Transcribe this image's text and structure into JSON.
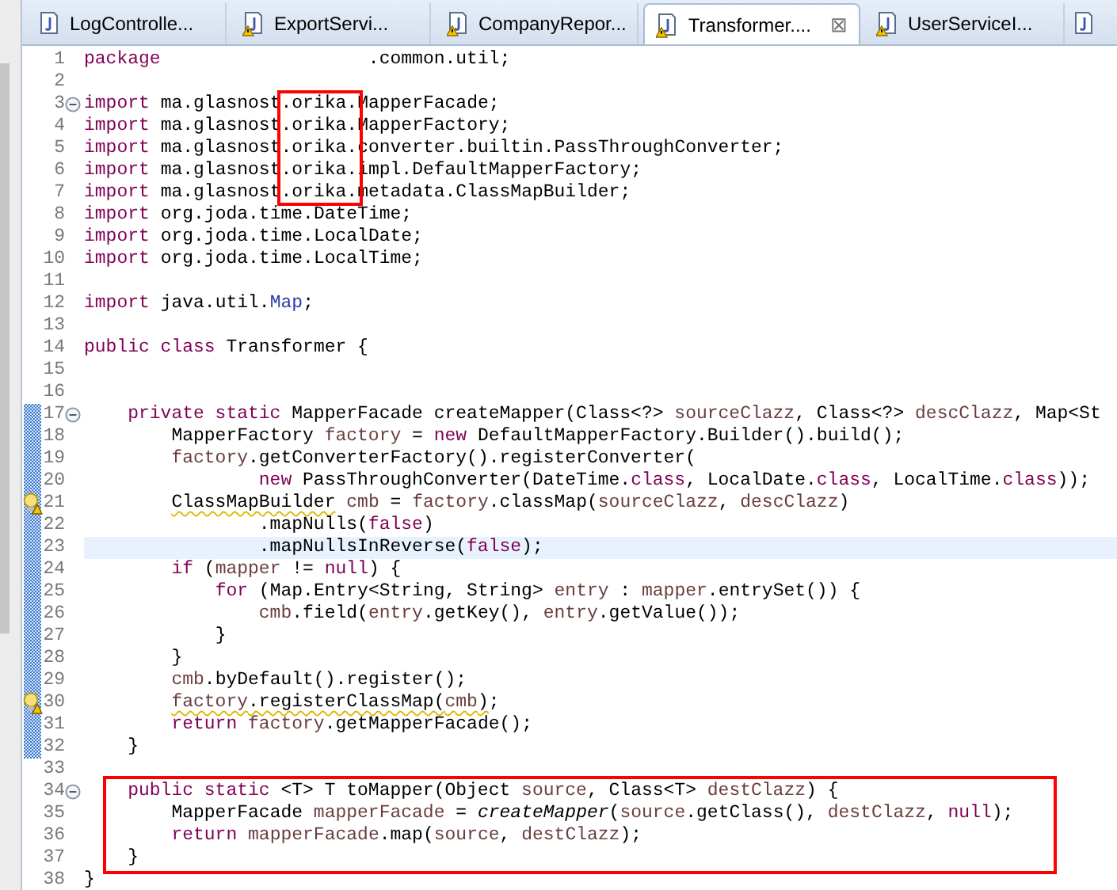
{
  "tabs": [
    {
      "label": "LogControlle...",
      "selected": false,
      "warning": false
    },
    {
      "label": "ExportServi...",
      "selected": false,
      "warning": true
    },
    {
      "label": "CompanyRepor...",
      "selected": false,
      "warning": true
    },
    {
      "label": "Transformer....",
      "selected": true,
      "warning": true,
      "close": "⊠"
    },
    {
      "label": "UserServiceI...",
      "selected": false,
      "warning": true
    },
    {
      "selected": false,
      "warning": false
    }
  ],
  "editor": {
    "lines": [
      {
        "number": "1",
        "kind": "plain",
        "changed": false,
        "current": false,
        "boxed": false,
        "tokens": [
          {
            "text": "package",
            "kind": "keyword"
          },
          {
            "text": "                   .common.util;",
            "kind": "plain"
          }
        ]
      },
      {
        "number": "2",
        "kind": "plain",
        "changed": false,
        "current": false,
        "boxed": false
      },
      {
        "number": "3",
        "kind": "fold",
        "changed": false,
        "current": false,
        "boxed": false,
        "tokens": [
          {
            "text": "import",
            "kind": "keyword"
          },
          {
            "text": " ma.glasnost",
            "kind": "plain"
          },
          {
            "text": ".orika.",
            "kind": "plain",
            "boxed": true
          },
          {
            "text": "MapperFacade;",
            "kind": "plain"
          }
        ]
      },
      {
        "number": "4",
        "kind": "plain",
        "changed": false,
        "current": false,
        "boxed": false,
        "tokens": [
          {
            "text": "import",
            "kind": "keyword"
          },
          {
            "text": " ma.glasnost",
            "kind": "plain"
          },
          {
            "text": ".orika.",
            "kind": "plain",
            "boxed": true
          },
          {
            "text": "MapperFactory;",
            "kind": "plain"
          }
        ]
      },
      {
        "number": "5",
        "kind": "plain",
        "changed": false,
        "current": false,
        "boxed": false,
        "tokens": [
          {
            "text": "import",
            "kind": "keyword"
          },
          {
            "text": " ma.glasnost",
            "kind": "plain"
          },
          {
            "text": ".orika.",
            "kind": "plain",
            "boxed": true
          },
          {
            "text": "converter.builtin.PassThroughConverter;",
            "kind": "plain"
          }
        ]
      },
      {
        "number": "6",
        "kind": "plain",
        "changed": false,
        "current": false,
        "boxed": false,
        "tokens": [
          {
            "text": "import",
            "kind": "keyword"
          },
          {
            "text": " ma.glasnost",
            "kind": "plain"
          },
          {
            "text": ".orika.",
            "kind": "plain",
            "boxed": true
          },
          {
            "text": "impl.DefaultMapperFactory;",
            "kind": "plain"
          }
        ]
      },
      {
        "number": "7",
        "kind": "plain",
        "changed": false,
        "current": false,
        "boxed": false,
        "tokens": [
          {
            "text": "import",
            "kind": "keyword"
          },
          {
            "text": " ma.glasnost",
            "kind": "plain"
          },
          {
            "text": ".orika.",
            "kind": "plain",
            "boxed": true
          },
          {
            "text": "metadata.ClassMapBuilder;",
            "kind": "plain"
          }
        ]
      },
      {
        "number": "8",
        "kind": "plain",
        "changed": false,
        "current": false,
        "boxed": false,
        "tokens": [
          {
            "text": "import",
            "kind": "keyword"
          },
          {
            "text": " org.joda.time.DateTime;",
            "kind": "plain"
          }
        ]
      },
      {
        "number": "9",
        "kind": "plain",
        "changed": false,
        "current": false,
        "boxed": false,
        "tokens": [
          {
            "text": "import",
            "kind": "keyword"
          },
          {
            "text": " org.joda.time.LocalDate;",
            "kind": "plain"
          }
        ]
      },
      {
        "number": "10",
        "kind": "plain",
        "changed": false,
        "current": false,
        "boxed": false,
        "tokens": [
          {
            "text": "import",
            "kind": "keyword"
          },
          {
            "text": " org.joda.time.LocalTime;",
            "kind": "plain"
          }
        ]
      },
      {
        "number": "11",
        "kind": "plain",
        "changed": false,
        "current": false,
        "boxed": false
      },
      {
        "number": "12",
        "kind": "plain",
        "changed": false,
        "current": false,
        "boxed": false,
        "tokens": [
          {
            "text": "import",
            "kind": "keyword"
          },
          {
            "text": " java.util.",
            "kind": "plain"
          },
          {
            "text": "Map",
            "kind": "type_ref"
          },
          {
            "text": ";",
            "kind": "plain"
          }
        ]
      },
      {
        "number": "13",
        "kind": "plain",
        "changed": false,
        "current": false,
        "boxed": false
      },
      {
        "number": "14",
        "kind": "plain",
        "changed": false,
        "current": false,
        "boxed": false,
        "tokens": [
          {
            "text": "public class",
            "kind": "keyword"
          },
          {
            "text": " Transformer {",
            "kind": "plain"
          }
        ]
      },
      {
        "number": "15",
        "kind": "plain",
        "changed": false,
        "current": false,
        "boxed": false
      },
      {
        "number": "16",
        "kind": "plain",
        "changed": false,
        "current": false,
        "boxed": false
      },
      {
        "number": "17",
        "kind": "fold",
        "changed": true,
        "current": false,
        "boxed": false,
        "tokens": [
          {
            "text": "    private static",
            "kind": "keyword"
          },
          {
            "text": " MapperFacade createMapper(Class<?> ",
            "kind": "plain"
          },
          {
            "text": "sourceClazz",
            "kind": "variable"
          },
          {
            "text": ", Class<?> ",
            "kind": "plain"
          },
          {
            "text": "descClazz",
            "kind": "variable"
          },
          {
            "text": ", Map<St",
            "kind": "plain"
          }
        ]
      },
      {
        "number": "18",
        "kind": "plain",
        "changed": true,
        "current": false,
        "boxed": false,
        "tokens": [
          {
            "text": "        MapperFactory ",
            "kind": "plain"
          },
          {
            "text": "factory",
            "kind": "variable"
          },
          {
            "text": " = ",
            "kind": "plain"
          },
          {
            "text": "new",
            "kind": "keyword"
          },
          {
            "text": " DefaultMapperFactory.Builder().build();",
            "kind": "plain"
          }
        ]
      },
      {
        "number": "19",
        "kind": "plain",
        "changed": true,
        "current": false,
        "boxed": false,
        "tokens": [
          {
            "text": "        factory",
            "kind": "variable"
          },
          {
            "text": ".getConverterFactory().registerConverter(",
            "kind": "plain"
          }
        ]
      },
      {
        "number": "20",
        "kind": "plain",
        "changed": true,
        "current": false,
        "boxed": false,
        "tokens": [
          {
            "text": "                new",
            "kind": "keyword"
          },
          {
            "text": " PassThroughConverter(DateTime.",
            "kind": "plain"
          },
          {
            "text": "class",
            "kind": "keyword"
          },
          {
            "text": ", LocalDate.",
            "kind": "plain"
          },
          {
            "text": "class",
            "kind": "keyword"
          },
          {
            "text": ", LocalTime.",
            "kind": "plain"
          },
          {
            "text": "class",
            "kind": "keyword"
          },
          {
            "text": "));",
            "kind": "plain"
          }
        ]
      },
      {
        "number": "21",
        "kind": "warning",
        "changed": true,
        "current": false,
        "boxed": false,
        "tokens": [
          {
            "text": "        ClassMapBuilder",
            "kind": "plain",
            "warning_underline": true
          },
          {
            "text": " cmb",
            "kind": "variable"
          },
          {
            "text": " = ",
            "kind": "plain"
          },
          {
            "text": "factory",
            "kind": "variable"
          },
          {
            "text": ".classMap(",
            "kind": "plain"
          },
          {
            "text": "sourceClazz",
            "kind": "variable"
          },
          {
            "text": ", ",
            "kind": "plain"
          },
          {
            "text": "descClazz",
            "kind": "variable"
          },
          {
            "text": ")",
            "kind": "plain"
          }
        ]
      },
      {
        "number": "22",
        "kind": "plain",
        "changed": true,
        "current": false,
        "boxed": false,
        "tokens": [
          {
            "text": "                .mapNulls(",
            "kind": "plain"
          },
          {
            "text": "false",
            "kind": "keyword"
          },
          {
            "text": ")",
            "kind": "plain"
          }
        ]
      },
      {
        "number": "23",
        "kind": "plain",
        "changed": true,
        "current": true,
        "boxed": false,
        "tokens": [
          {
            "text": "                .mapNullsInReverse(",
            "kind": "plain"
          },
          {
            "text": "false",
            "kind": "keyword"
          },
          {
            "text": ");",
            "kind": "plain"
          }
        ]
      },
      {
        "number": "24",
        "kind": "plain",
        "changed": true,
        "current": false,
        "boxed": false,
        "tokens": [
          {
            "text": "        if",
            "kind": "keyword"
          },
          {
            "text": " (",
            "kind": "plain"
          },
          {
            "text": "mapper",
            "kind": "variable"
          },
          {
            "text": " != ",
            "kind": "plain"
          },
          {
            "text": "null",
            "kind": "keyword"
          },
          {
            "text": ") {",
            "kind": "plain"
          }
        ]
      },
      {
        "number": "25",
        "kind": "plain",
        "changed": true,
        "current": false,
        "boxed": false,
        "tokens": [
          {
            "text": "            for",
            "kind": "keyword"
          },
          {
            "text": " (Map.Entry<String, String> ",
            "kind": "plain"
          },
          {
            "text": "entry",
            "kind": "variable"
          },
          {
            "text": " : ",
            "kind": "plain"
          },
          {
            "text": "mapper",
            "kind": "variable"
          },
          {
            "text": ".entrySet()) {",
            "kind": "plain"
          }
        ]
      },
      {
        "number": "26",
        "kind": "plain",
        "changed": true,
        "current": false,
        "boxed": false,
        "tokens": [
          {
            "text": "                cmb",
            "kind": "variable"
          },
          {
            "text": ".field(",
            "kind": "plain"
          },
          {
            "text": "entry",
            "kind": "variable"
          },
          {
            "text": ".getKey(), ",
            "kind": "plain"
          },
          {
            "text": "entry",
            "kind": "variable"
          },
          {
            "text": ".getValue());",
            "kind": "plain"
          }
        ]
      },
      {
        "number": "27",
        "kind": "plain",
        "changed": true,
        "current": false,
        "boxed": false,
        "tokens": [
          {
            "text": "            }",
            "kind": "plain"
          }
        ]
      },
      {
        "number": "28",
        "kind": "plain",
        "changed": true,
        "current": false,
        "boxed": false,
        "tokens": [
          {
            "text": "        }",
            "kind": "plain"
          }
        ]
      },
      {
        "number": "29",
        "kind": "plain",
        "changed": true,
        "current": false,
        "boxed": false,
        "tokens": [
          {
            "text": "        cmb",
            "kind": "variable"
          },
          {
            "text": ".byDefault().register();",
            "kind": "plain"
          }
        ]
      },
      {
        "number": "30",
        "kind": "warning",
        "changed": true,
        "current": false,
        "boxed": false,
        "tokens": [
          {
            "text": "        factory",
            "kind": "variable",
            "warning_underline": true
          },
          {
            "text": ".registerClassMap(",
            "kind": "plain",
            "warning_underline": true
          },
          {
            "text": "cmb",
            "kind": "variable",
            "warning_underline": true
          },
          {
            "text": ")",
            "kind": "plain",
            "warning_underline": true
          },
          {
            "text": ";",
            "kind": "plain"
          }
        ]
      },
      {
        "number": "31",
        "kind": "plain",
        "changed": true,
        "current": false,
        "boxed": false,
        "tokens": [
          {
            "text": "        return",
            "kind": "keyword"
          },
          {
            "text": " factory",
            "kind": "variable"
          },
          {
            "text": ".getMapperFacade();",
            "kind": "plain"
          }
        ]
      },
      {
        "number": "32",
        "kind": "plain",
        "changed": true,
        "current": false,
        "boxed": false,
        "tokens": [
          {
            "text": "    }",
            "kind": "plain"
          }
        ]
      },
      {
        "number": "33",
        "kind": "plain",
        "changed": false,
        "current": false,
        "boxed": false
      },
      {
        "number": "34",
        "kind": "fold",
        "changed": false,
        "current": false,
        "boxed": true,
        "tokens": [
          {
            "text": "    public static",
            "kind": "keyword"
          },
          {
            "text": " <T> T toMapper(Object ",
            "kind": "plain"
          },
          {
            "text": "source",
            "kind": "variable"
          },
          {
            "text": ", Class<T> ",
            "kind": "plain"
          },
          {
            "text": "destClazz",
            "kind": "variable"
          },
          {
            "text": ") {",
            "kind": "plain"
          }
        ]
      },
      {
        "number": "35",
        "kind": "plain",
        "changed": false,
        "current": false,
        "boxed": true,
        "tokens": [
          {
            "text": "        MapperFacade ",
            "kind": "plain"
          },
          {
            "text": "mapperFacade",
            "kind": "variable"
          },
          {
            "text": " = ",
            "kind": "plain"
          },
          {
            "text": "createMapper",
            "kind": "italic"
          },
          {
            "text": "(",
            "kind": "plain"
          },
          {
            "text": "source",
            "kind": "variable"
          },
          {
            "text": ".getClass(), ",
            "kind": "plain"
          },
          {
            "text": "destClazz",
            "kind": "variable"
          },
          {
            "text": ", ",
            "kind": "plain"
          },
          {
            "text": "null",
            "kind": "keyword"
          },
          {
            "text": ");",
            "kind": "plain"
          }
        ]
      },
      {
        "number": "36",
        "kind": "plain",
        "changed": false,
        "current": false,
        "boxed": true,
        "tokens": [
          {
            "text": "        return",
            "kind": "keyword"
          },
          {
            "text": " mapperFacade",
            "kind": "variable"
          },
          {
            "text": ".map(",
            "kind": "plain"
          },
          {
            "text": "source",
            "kind": "variable"
          },
          {
            "text": ", ",
            "kind": "plain"
          },
          {
            "text": "destClazz",
            "kind": "variable"
          },
          {
            "text": ");",
            "kind": "plain"
          }
        ]
      },
      {
        "number": "37",
        "kind": "plain",
        "changed": false,
        "current": false,
        "boxed": true,
        "tokens": [
          {
            "text": "    }",
            "kind": "plain"
          }
        ]
      },
      {
        "number": "38",
        "kind": "plain",
        "changed": false,
        "current": false,
        "boxed": false,
        "tokens": [
          {
            "text": "}",
            "kind": "plain"
          }
        ]
      }
    ]
  }
}
